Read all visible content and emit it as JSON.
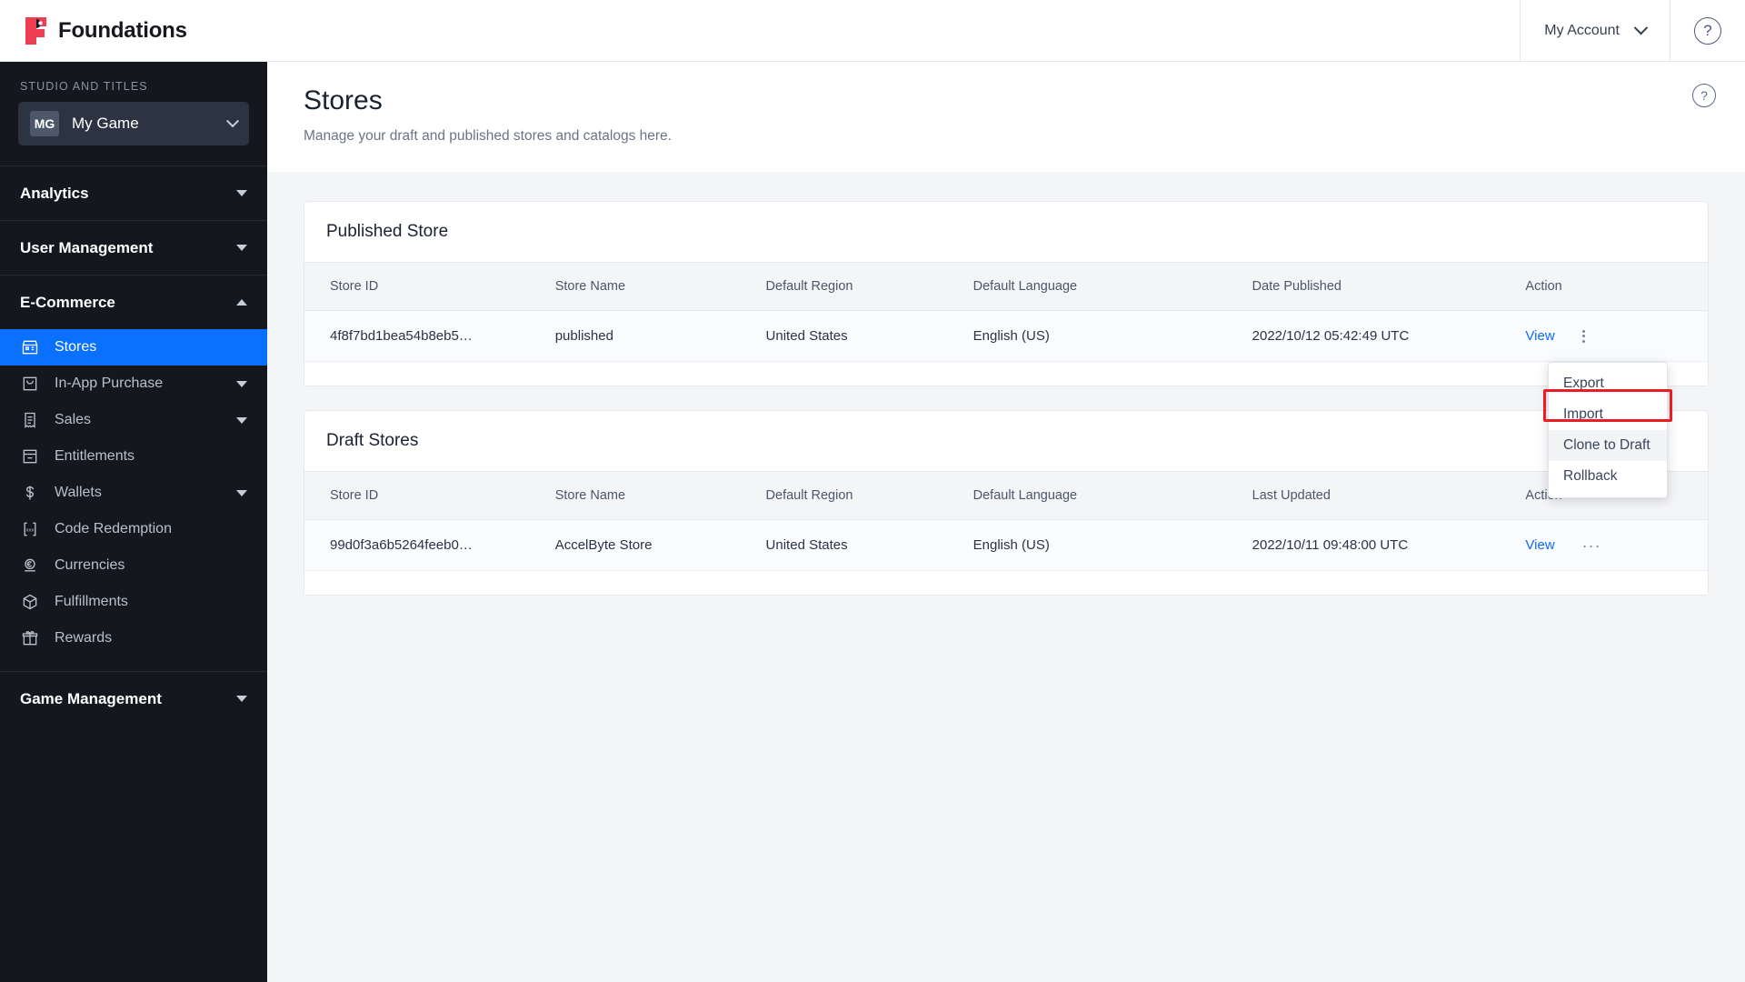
{
  "topbar": {
    "brand": "Foundations",
    "brand_color": "#ef3d51",
    "account_label": "My Account",
    "help_glyph": "?"
  },
  "sidebar": {
    "section_label": "STUDIO AND TITLES",
    "title_badge": "MG",
    "title_name": "My Game",
    "groups": [
      {
        "label": "Analytics",
        "expanded": false
      },
      {
        "label": "User Management",
        "expanded": false
      },
      {
        "label": "E-Commerce",
        "expanded": true
      },
      {
        "label": "Game Management",
        "expanded": false
      }
    ],
    "ecommerce_items": [
      {
        "label": "Stores",
        "icon": "store-icon",
        "active": true,
        "has_submenu": false
      },
      {
        "label": "In-App Purchase",
        "icon": "bag-icon",
        "active": false,
        "has_submenu": true
      },
      {
        "label": "Sales",
        "icon": "receipt-icon",
        "active": false,
        "has_submenu": true
      },
      {
        "label": "Entitlements",
        "icon": "archive-icon",
        "active": false,
        "has_submenu": false
      },
      {
        "label": "Wallets",
        "icon": "dollar-icon",
        "active": false,
        "has_submenu": true
      },
      {
        "label": "Code Redemption",
        "icon": "code-brackets-icon",
        "active": false,
        "has_submenu": false
      },
      {
        "label": "Currencies",
        "icon": "coin-euro-icon",
        "active": false,
        "has_submenu": false
      },
      {
        "label": "Fulfillments",
        "icon": "box-icon",
        "active": false,
        "has_submenu": false
      },
      {
        "label": "Rewards",
        "icon": "gift-icon",
        "active": false,
        "has_submenu": false
      }
    ],
    "active_accent": "#0a70ff"
  },
  "page": {
    "title": "Stores",
    "subtitle": "Manage your draft and published stores and catalogs here.",
    "help_glyph": "?"
  },
  "published_panel": {
    "heading": "Published Store",
    "columns": [
      "Store ID",
      "Store Name",
      "Default Region",
      "Default Language",
      "Date Published",
      "Action"
    ],
    "rows": [
      {
        "store_id": "4f8f7bd1bea54b8eb5…",
        "store_name": "published",
        "default_region": "United States",
        "default_language": "English (US)",
        "date": "2022/10/12 05:42:49 UTC",
        "action_view": "View"
      }
    ]
  },
  "draft_panel": {
    "heading": "Draft Stores",
    "columns": [
      "Store ID",
      "Store Name",
      "Default Region",
      "Default Language",
      "Last Updated",
      "Action"
    ],
    "rows": [
      {
        "store_id": "99d0f3a6b5264feeb0…",
        "store_name": "AccelByte Store",
        "default_region": "United States",
        "default_language": "English (US)",
        "date": "2022/10/11 09:48:00 UTC",
        "action_view": "View"
      }
    ]
  },
  "context_menu": {
    "items": [
      {
        "label": "Export",
        "highlighted": false
      },
      {
        "label": "Import",
        "highlighted": false
      },
      {
        "label": "Clone to Draft",
        "highlighted": true
      },
      {
        "label": "Rollback",
        "highlighted": false
      }
    ],
    "highlight_color": "#ec1c24"
  }
}
